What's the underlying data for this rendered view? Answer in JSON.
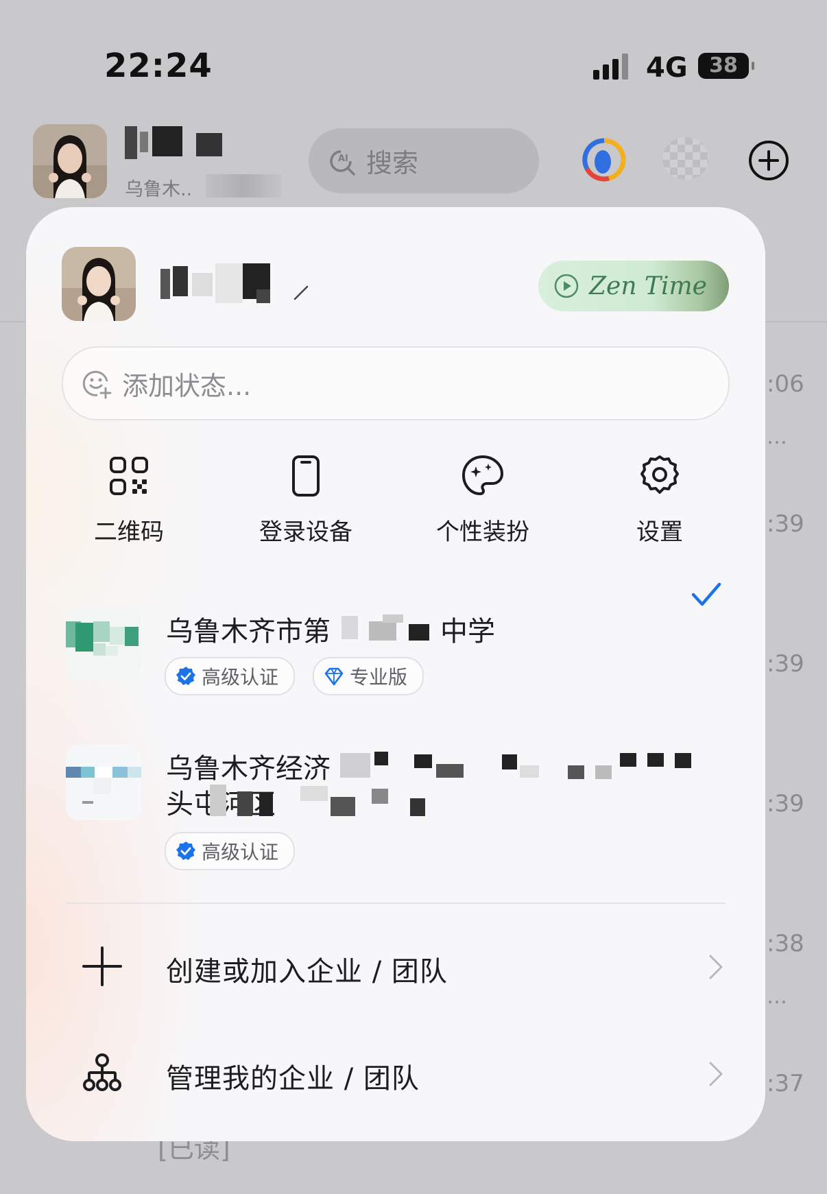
{
  "status_bar": {
    "time": "22:24",
    "network": "4G",
    "battery": "38"
  },
  "header": {
    "subtitle": "乌鲁木..",
    "search_placeholder": "搜索"
  },
  "background_list": {
    "times": [
      ":06",
      ":39",
      ":39",
      ":39",
      ":38",
      ":37"
    ],
    "bottom_text": "[已读]"
  },
  "panel": {
    "zen_time_label": "Zen Time",
    "status_placeholder": "添加状态...",
    "quick_actions": [
      {
        "label": "二维码",
        "icon": "qr-code-icon"
      },
      {
        "label": "登录设备",
        "icon": "phone-device-icon"
      },
      {
        "label": "个性装扮",
        "icon": "palette-icon"
      },
      {
        "label": "设置",
        "icon": "gear-icon"
      }
    ],
    "orgs": [
      {
        "name": "乌鲁木齐市第",
        "name_tail": "中学",
        "badges": [
          "高级认证",
          "专业版"
        ],
        "selected": true
      },
      {
        "name": "乌鲁木齐经济",
        "name_line2": "头屯河区",
        "badges": [
          "高级认证"
        ],
        "selected": false
      }
    ],
    "actions": [
      {
        "label": "创建或加入企业 / 团队",
        "icon": "plus-icon"
      },
      {
        "label": "管理我的企业 / 团队",
        "icon": "org-tree-icon"
      }
    ]
  },
  "colors": {
    "accent": "#1a73e8",
    "zen_text": "#3f7a53",
    "panel_bg": "#f7f7f9",
    "overlay_bg": "#c9c9cb"
  }
}
